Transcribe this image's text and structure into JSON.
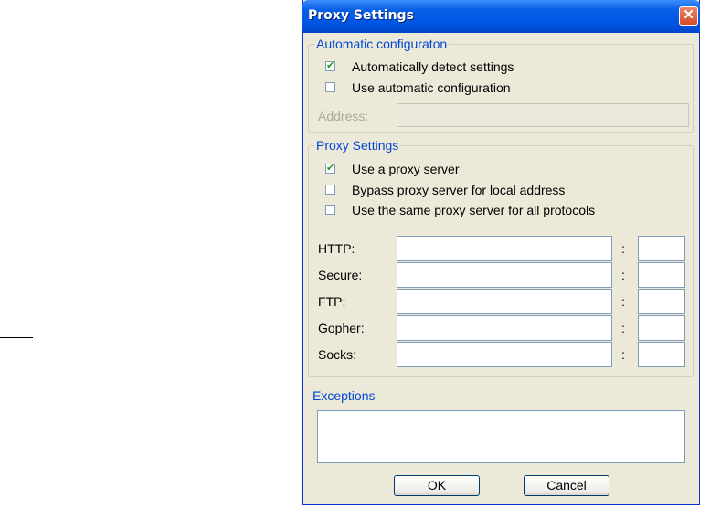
{
  "window": {
    "title": "Proxy Settings",
    "close_symbol": "✕"
  },
  "auto_config": {
    "legend": "Automatic configuraton",
    "detect_label": "Automatically detect settings",
    "detect_checked": true,
    "use_auto_label": "Use automatic configuration",
    "use_auto_checked": false,
    "address_label": "Address:",
    "address_value": ""
  },
  "proxy": {
    "legend": "Proxy Settings",
    "use_proxy_label": "Use a proxy server",
    "use_proxy_checked": true,
    "bypass_label": "Bypass proxy server for local address",
    "bypass_checked": false,
    "same_label": "Use the same proxy server for all protocols",
    "same_checked": false,
    "colon": ":",
    "rows": [
      {
        "label": "HTTP:",
        "host": "",
        "port": ""
      },
      {
        "label": "Secure:",
        "host": "",
        "port": ""
      },
      {
        "label": "FTP:",
        "host": "",
        "port": ""
      },
      {
        "label": "Gopher:",
        "host": "",
        "port": ""
      },
      {
        "label": "Socks:",
        "host": "",
        "port": ""
      }
    ]
  },
  "exceptions": {
    "label": "Exceptions",
    "value": ""
  },
  "buttons": {
    "ok": "OK",
    "cancel": "Cancel"
  },
  "check_symbol": "✔"
}
